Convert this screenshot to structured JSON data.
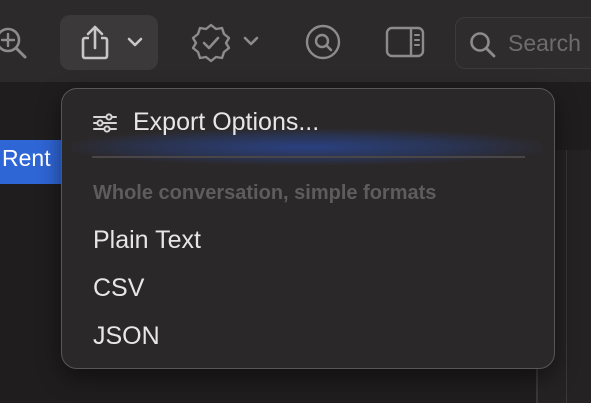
{
  "toolbar": {
    "icons": [
      "zoom-in-icon",
      "share-icon",
      "chevron-down-icon",
      "verified-badge-icon",
      "magnifier-icon",
      "sidebar-toggle-icon",
      "search-icon"
    ],
    "search_placeholder": "Search"
  },
  "list": {
    "selected_row_text": "Rent"
  },
  "export_menu": {
    "export_options_label": "Export Options...",
    "section_header": "Whole conversation, simple formats",
    "formats": [
      "Plain Text",
      "CSV",
      "JSON"
    ]
  },
  "colors": {
    "selection_accent": "#2f66d6",
    "menu_background": "#2b2829",
    "hover_glow": "#2855c8"
  }
}
